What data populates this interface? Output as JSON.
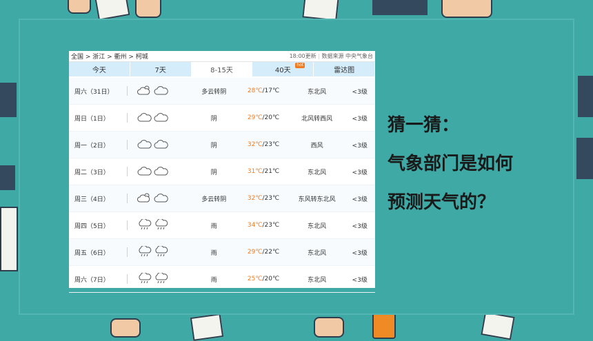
{
  "weather": {
    "breadcrumb": "全国 > 浙江 > 衢州 > 柯城",
    "update_time": "18:00更新",
    "source": "数据来源 中央气象台",
    "tabs": [
      {
        "label": "今天"
      },
      {
        "label": "7天"
      },
      {
        "label": "8-15天"
      },
      {
        "label": "40天",
        "badge": "hot"
      },
      {
        "label": "雷达图"
      }
    ],
    "active_tab": "8-15天",
    "rows": [
      {
        "date": "周六（31日）",
        "desc": "多云转阴",
        "hi": "28℃",
        "lo": "/17℃",
        "wind": "东北风",
        "level": "<3级",
        "icons": [
          "partly-cloudy-icon",
          "cloudy-icon"
        ]
      },
      {
        "date": "周日（1日）",
        "desc": "阴",
        "hi": "29℃",
        "lo": "/20℃",
        "wind": "北风转西风",
        "level": "<3级",
        "icons": [
          "cloudy-icon",
          "cloudy-icon"
        ]
      },
      {
        "date": "周一（2日）",
        "desc": "阴",
        "hi": "32℃",
        "lo": "/23℃",
        "wind": "西风",
        "level": "<3级",
        "icons": [
          "cloudy-icon",
          "cloudy-icon"
        ]
      },
      {
        "date": "周二（3日）",
        "desc": "阴",
        "hi": "31℃",
        "lo": "/21℃",
        "wind": "东北风",
        "level": "<3级",
        "icons": [
          "cloudy-icon",
          "cloudy-icon"
        ]
      },
      {
        "date": "周三（4日）",
        "desc": "多云转阴",
        "hi": "32℃",
        "lo": "/23℃",
        "wind": "东风转东北风",
        "level": "<3级",
        "icons": [
          "partly-cloudy-icon",
          "cloudy-icon"
        ]
      },
      {
        "date": "周四（5日）",
        "desc": "雨",
        "hi": "34℃",
        "lo": "/23℃",
        "wind": "东北风",
        "level": "<3级",
        "icons": [
          "rain-icon",
          "rain-icon"
        ]
      },
      {
        "date": "周五（6日）",
        "desc": "雨",
        "hi": "29℃",
        "lo": "/22℃",
        "wind": "东北风",
        "level": "<3级",
        "icons": [
          "rain-icon",
          "rain-icon"
        ]
      },
      {
        "date": "周六（7日）",
        "desc": "雨",
        "hi": "25℃",
        "lo": "/20℃",
        "wind": "东北风",
        "level": "<3级",
        "icons": [
          "rain-icon",
          "rain-icon"
        ]
      }
    ]
  },
  "question": {
    "line1": "猜一猜：",
    "line2": "气象部门是如何",
    "line3": "预测天气的？"
  },
  "colors": {
    "background": "#3fa9a5",
    "tab_bar": "#d5ecfa",
    "temp_high": "#f07b1e"
  }
}
